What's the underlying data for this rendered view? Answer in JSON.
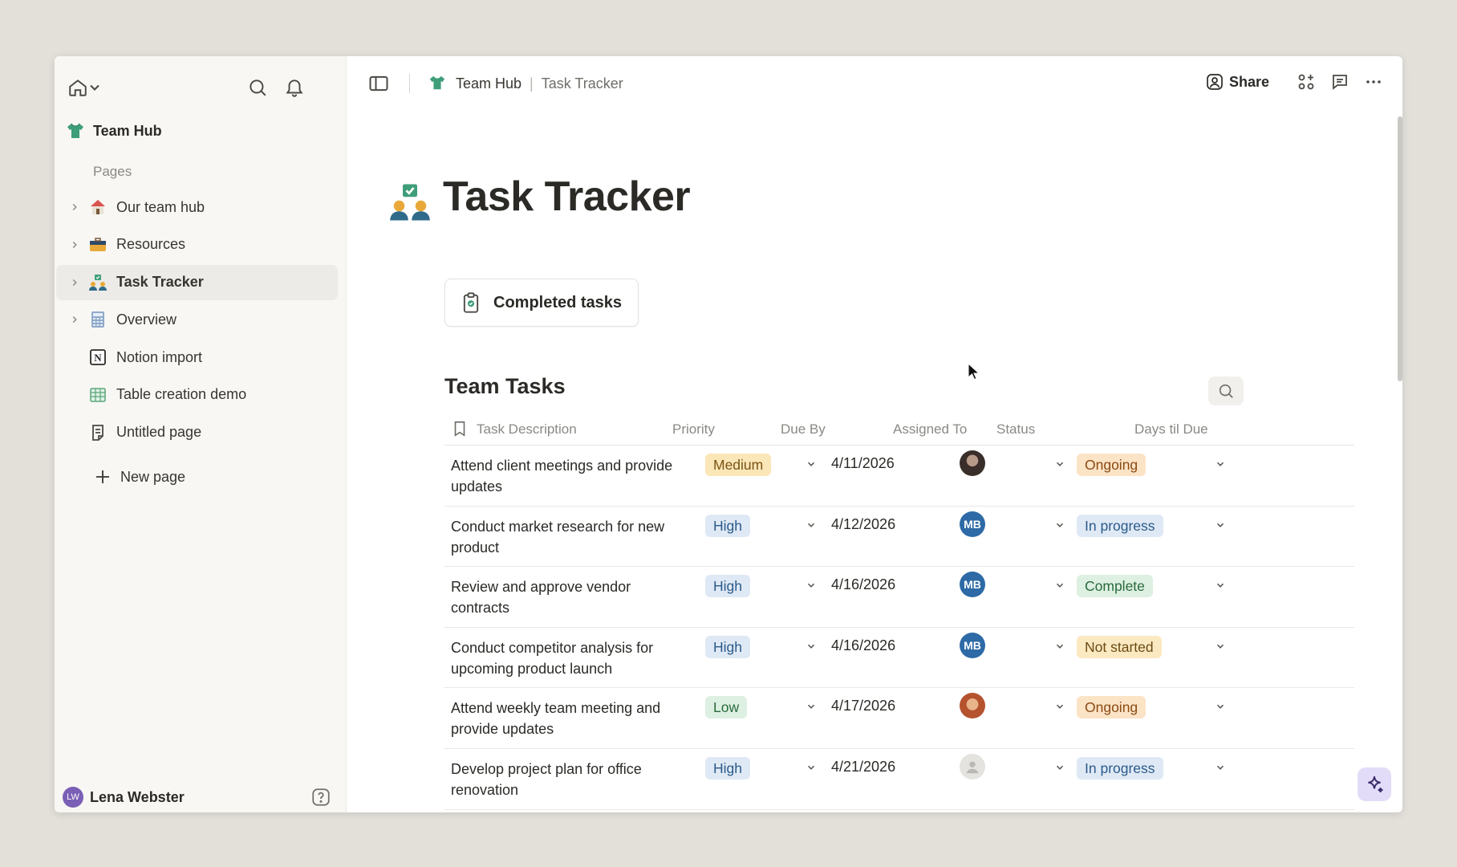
{
  "sidebar": {
    "workspace_name": "Team Hub",
    "pages_label": "Pages",
    "items": [
      {
        "label": "Our team hub",
        "icon": "house-icon",
        "has_children": true,
        "active": false
      },
      {
        "label": "Resources",
        "icon": "briefcase-icon",
        "has_children": true,
        "active": false
      },
      {
        "label": "Task Tracker",
        "icon": "people-check-icon",
        "has_children": true,
        "active": true
      },
      {
        "label": "Overview",
        "icon": "calculator-icon",
        "has_children": true,
        "active": false
      },
      {
        "label": "Notion import",
        "icon": "notion-icon",
        "has_children": false,
        "active": false
      },
      {
        "label": "Table creation demo",
        "icon": "table-icon",
        "has_children": false,
        "active": false
      },
      {
        "label": "Untitled page",
        "icon": "page-icon",
        "has_children": false,
        "active": false
      }
    ],
    "new_page_label": "New page",
    "user": {
      "initials": "LW",
      "name": "Lena Webster"
    }
  },
  "topbar": {
    "breadcrumb": {
      "workspace": "Team Hub",
      "separator": "|",
      "page": "Task Tracker"
    },
    "share_label": "Share"
  },
  "page": {
    "title": "Task Tracker",
    "completed_button": "Completed tasks",
    "section_title": "Team Tasks"
  },
  "table": {
    "columns": [
      "Task Description",
      "Priority",
      "Due By",
      "Assigned To",
      "Status",
      "Days til Due"
    ],
    "rows": [
      {
        "desc": "Attend client meetings and provide updates",
        "priority": "Medium",
        "due": "4/11/2026",
        "assignee": {
          "type": "photo-dark",
          "initials": ""
        },
        "status": "Ongoing"
      },
      {
        "desc": "Conduct market research for new product",
        "priority": "High",
        "due": "4/12/2026",
        "assignee": {
          "type": "initials",
          "initials": "MB"
        },
        "status": "In progress"
      },
      {
        "desc": "Review and approve vendor contracts",
        "priority": "High",
        "due": "4/16/2026",
        "assignee": {
          "type": "initials",
          "initials": "MB"
        },
        "status": "Complete"
      },
      {
        "desc": "Conduct competitor analysis for upcoming product launch",
        "priority": "High",
        "due": "4/16/2026",
        "assignee": {
          "type": "initials",
          "initials": "MB"
        },
        "status": "Not started"
      },
      {
        "desc": "Attend weekly team meeting and provide updates",
        "priority": "Low",
        "due": "4/17/2026",
        "assignee": {
          "type": "photo-warm",
          "initials": ""
        },
        "status": "Ongoing"
      },
      {
        "desc": "Develop project plan for office renovation",
        "priority": "High",
        "due": "4/21/2026",
        "assignee": {
          "type": "placeholder",
          "initials": ""
        },
        "status": "In progress"
      }
    ]
  },
  "colors": {
    "priority": {
      "Medium": [
        "#fbe6b8",
        "#7a5413"
      ],
      "High": [
        "#dfe9f5",
        "#2b5a8a"
      ],
      "Low": [
        "#ddf0e2",
        "#2b6a3c"
      ]
    },
    "status": {
      "Ongoing": [
        "#fbe3c6",
        "#8a4a12"
      ],
      "In progress": [
        "#dfe9f5",
        "#2b5a8a"
      ],
      "Complete": [
        "#ddf0e2",
        "#2b6a3c"
      ],
      "Not started": [
        "#fbe9c2",
        "#6b4a12"
      ]
    },
    "initials_avatar": "#2d6aa6"
  }
}
